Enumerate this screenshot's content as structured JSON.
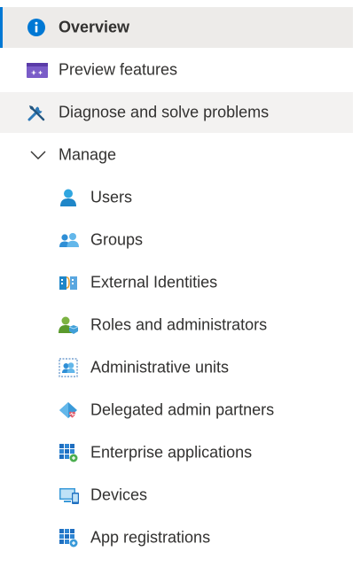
{
  "nav": {
    "overview": {
      "label": "Overview",
      "icon": "info-icon"
    },
    "preview": {
      "label": "Preview features",
      "icon": "preview-features-icon"
    },
    "diagnose": {
      "label": "Diagnose and solve problems",
      "icon": "wrench-screwdriver-icon"
    },
    "manage": {
      "label": "Manage",
      "icon": "chevron-down-icon",
      "expanded": true
    },
    "manage_items": [
      {
        "label": "Users",
        "icon": "user-icon"
      },
      {
        "label": "Groups",
        "icon": "groups-icon"
      },
      {
        "label": "External Identities",
        "icon": "external-identities-icon"
      },
      {
        "label": "Roles and administrators",
        "icon": "roles-admin-icon"
      },
      {
        "label": "Administrative units",
        "icon": "admin-units-icon"
      },
      {
        "label": "Delegated admin partners",
        "icon": "delegated-admin-icon"
      },
      {
        "label": "Enterprise applications",
        "icon": "enterprise-apps-icon"
      },
      {
        "label": "Devices",
        "icon": "devices-icon"
      },
      {
        "label": "App registrations",
        "icon": "app-registrations-icon"
      }
    ]
  },
  "colors": {
    "accent": "#0078d4",
    "selected_bg": "#edebe9",
    "hover_bg": "#f3f2f1"
  }
}
